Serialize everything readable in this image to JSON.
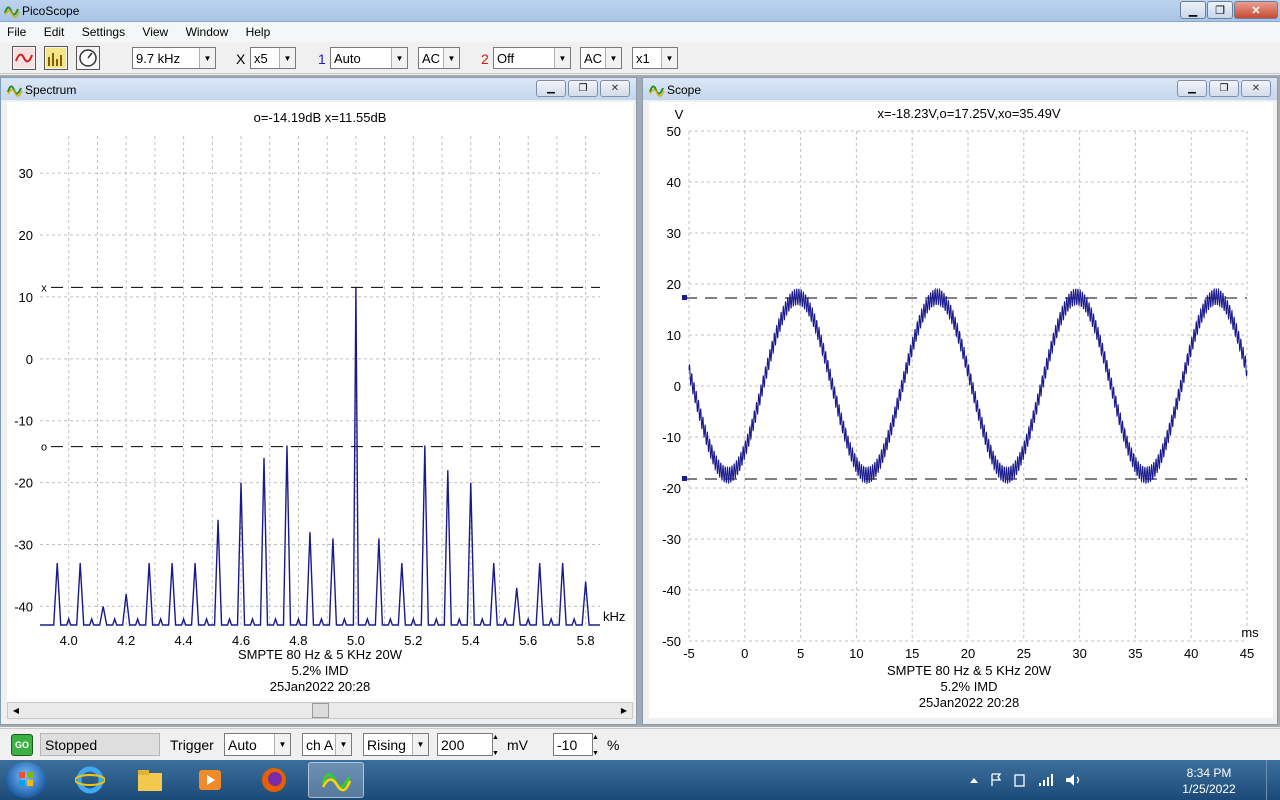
{
  "window": {
    "title": "PicoScope"
  },
  "menu": [
    "File",
    "Edit",
    "Settings",
    "View",
    "Window",
    "Help"
  ],
  "toolbar": {
    "timebase": "9.7 kHz",
    "x_label": "X",
    "x_mult": "x5",
    "ch1_label": "1",
    "ch1_range": "Auto",
    "ch1_coupling": "AC",
    "ch2_label": "2",
    "ch2_range": "Off",
    "ch2_coupling": "AC",
    "mult": "x1"
  },
  "spectrum": {
    "title": "Spectrum",
    "readout": "o=-14.19dB  x=11.55dB",
    "caption": [
      "SMPTE 80 Hz & 5 KHz 20W",
      "5.2% IMD",
      "25Jan2022  20:28"
    ]
  },
  "scope": {
    "title": "Scope",
    "readout": "x=-18.23V,o=17.25V,xo=35.49V",
    "caption": [
      "SMPTE 80 Hz & 5 KHz 20W",
      "5.2% IMD",
      "25Jan2022  20:28"
    ]
  },
  "chart_data": [
    {
      "type": "line",
      "xlabel": "kHz",
      "ylabel": "",
      "xlim": [
        3.9,
        5.85
      ],
      "ylim": [
        -43,
        36
      ],
      "x_ticks": [
        "4.0",
        "4.2",
        "4.4",
        "4.6",
        "4.8",
        "5.0",
        "5.2",
        "5.4",
        "5.6",
        "5.8"
      ],
      "y_ticks": [
        "30",
        "20",
        "10",
        "0",
        "-10",
        "-20",
        "-30",
        "-40"
      ],
      "grid": true,
      "markers": [
        {
          "label": "x",
          "value": 11.55
        },
        {
          "label": "o",
          "value": -14.19
        }
      ],
      "peaks_khz": [
        3.96,
        4.04,
        4.12,
        4.2,
        4.28,
        4.36,
        4.44,
        4.52,
        4.6,
        4.68,
        4.76,
        4.84,
        4.92,
        5.0,
        5.08,
        5.16,
        5.24,
        5.32,
        5.4,
        5.48,
        5.56,
        5.64,
        5.72,
        5.8
      ],
      "peaks_db": [
        -33,
        -33,
        -40,
        -38,
        -33,
        -33,
        -33,
        -26,
        -20,
        -16,
        -14,
        -28,
        -29,
        11.5,
        -29,
        -33,
        -14,
        -18,
        -20,
        -33,
        -37,
        -33,
        -33,
        -36
      ],
      "floor_db": -43
    },
    {
      "type": "line",
      "xlabel": "ms",
      "ylabel": "V",
      "xlim": [
        -5,
        45
      ],
      "ylim": [
        -50,
        50
      ],
      "x_ticks": [
        "-5",
        "0",
        "5",
        "10",
        "15",
        "20",
        "25",
        "30",
        "35",
        "40",
        "45"
      ],
      "y_ticks": [
        "50",
        "40",
        "30",
        "20",
        "10",
        "0",
        "-10",
        "-20",
        "-30",
        "-40",
        "-50"
      ],
      "grid": true,
      "markers": [
        {
          "label": "o",
          "value": 17.25
        },
        {
          "label": "x",
          "value": -18.23
        }
      ],
      "signal": {
        "carrier_hz": 80,
        "carrier_amp_v": 17.5,
        "mod_hz": 5000,
        "mod_amp_v": 1.6,
        "phase_ms": 1.6
      }
    }
  ],
  "status": {
    "go_label": "GO",
    "state": "Stopped",
    "trigger_label": "Trigger",
    "trigger_mode": "Auto",
    "trigger_channel": "ch A",
    "trigger_edge": "Rising",
    "trigger_level": "200",
    "trigger_unit": "mV",
    "pretrigger": "-10",
    "pretrigger_unit": "%"
  },
  "taskbar": {
    "time": "8:34 PM",
    "date": "1/25/2022",
    "apps": [
      "start-orb",
      "internet-explorer-icon",
      "file-explorer-icon",
      "media-player-icon",
      "firefox-icon",
      "picoscope-icon"
    ]
  }
}
